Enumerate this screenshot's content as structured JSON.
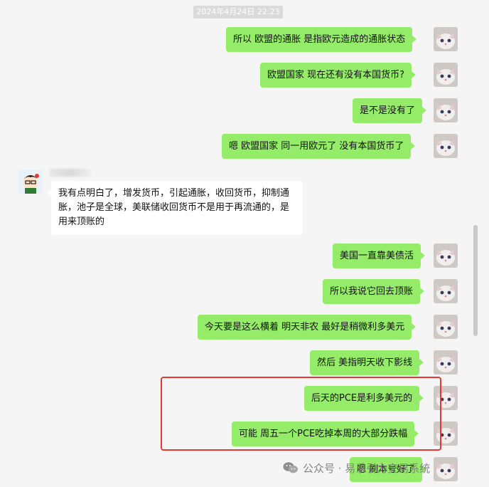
{
  "chat": {
    "timestamp": "2024年4月24日 22:23",
    "messages": [
      {
        "id": "m1",
        "side": "right",
        "text": "所以 欧盟的通胀 是指欧元造成的通胀状态"
      },
      {
        "id": "m2",
        "side": "right",
        "text": "欧盟国家 现在还有没有本国货币?"
      },
      {
        "id": "m3",
        "side": "right",
        "text": "是不是没有了"
      },
      {
        "id": "m4",
        "side": "right",
        "text": "嗯 欧盟国家 同一用欧元了 没有本国货币了"
      },
      {
        "id": "m5",
        "side": "left",
        "text": "我有点明白了，增发货币，引起通胀，收回货币，抑制通胀，池子是全球，美联储收回货币不是用于再流通的，是用来顶账的"
      },
      {
        "id": "m6",
        "side": "right",
        "text": "美国一直靠美债活"
      },
      {
        "id": "m7",
        "side": "right",
        "text": "所以我说它回去顶账"
      },
      {
        "id": "m8",
        "side": "right",
        "text": "今天要是这么横着 明天非农 最好是稍微利多美元"
      },
      {
        "id": "m9",
        "side": "right",
        "text": "然后 美指明天收下影线"
      },
      {
        "id": "m10",
        "side": "right",
        "text": "后天的PCE是利多美元的"
      },
      {
        "id": "m11",
        "side": "right",
        "text": "可能 周五一个PCE吃掉本周的大部分跌幅"
      },
      {
        "id": "m12",
        "side": "right",
        "text": "嗯 刷本号好了"
      }
    ]
  },
  "watermark": {
    "label": "公众号 · 易系引力交易系统",
    "icon": "wechat-icon"
  },
  "colors": {
    "bubble_right": "#95ec69",
    "bubble_left": "#ffffff",
    "background": "#f5f5f5",
    "highlight": "#e53935"
  }
}
